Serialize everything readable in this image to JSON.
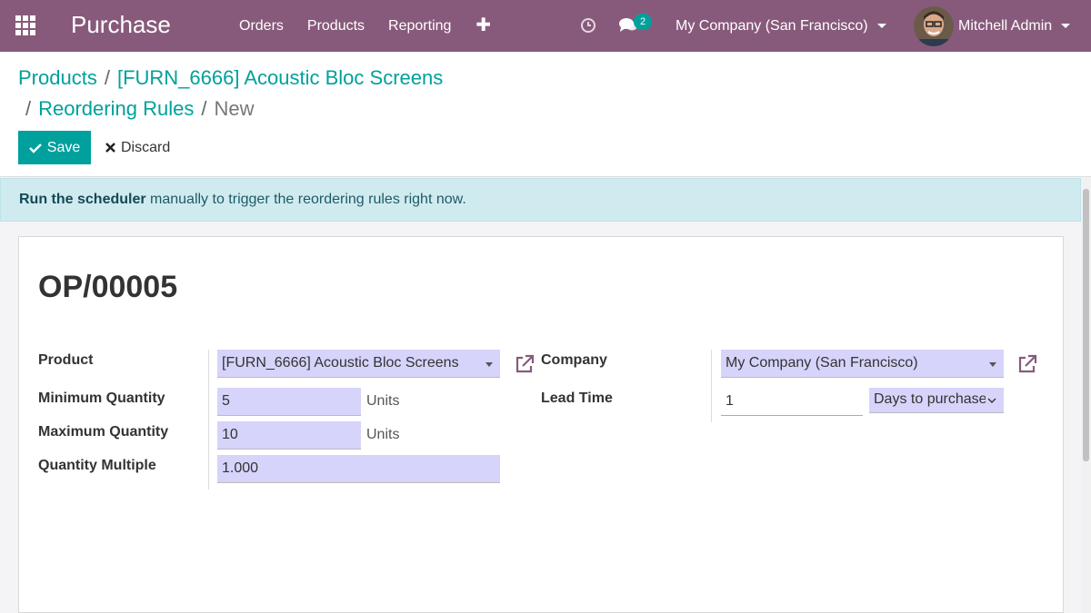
{
  "navbar": {
    "app_title": "Purchase",
    "menu": [
      "Orders",
      "Products",
      "Reporting"
    ],
    "plus_label": "✚",
    "chat_count": "2",
    "company": "My Company (San Francisco)",
    "user": "Mitchell Admin",
    "bg_color": "#875a7b"
  },
  "breadcrumb": {
    "products": "Products",
    "product": "[FURN_6666] Acoustic Bloc Screens",
    "reordering_rules": "Reordering Rules",
    "current": "New",
    "sep": "/"
  },
  "buttons": {
    "save": "Save",
    "discard": "Discard"
  },
  "alert": {
    "link": "Run the scheduler",
    "text": " manually to trigger the reordering rules right now."
  },
  "record": {
    "name": "OP/00005",
    "labels": {
      "product": "Product",
      "min_qty": "Minimum Quantity",
      "max_qty": "Maximum Quantity",
      "qty_multiple": "Quantity Multiple",
      "company": "Company",
      "lead_time": "Lead Time"
    },
    "values": {
      "product": "[FURN_6666] Acoustic Bloc Screens",
      "min_qty": "5",
      "min_unit": "Units",
      "max_qty": "10",
      "max_unit": "Units",
      "qty_multiple": "1.000",
      "company": "My Company (San Francisco)",
      "lead_time": "1",
      "lead_type": "Days to purchase"
    }
  },
  "colors": {
    "accent": "#00a09d",
    "required_field": "#d6d4fa",
    "alert_bg": "#d0ebef"
  }
}
